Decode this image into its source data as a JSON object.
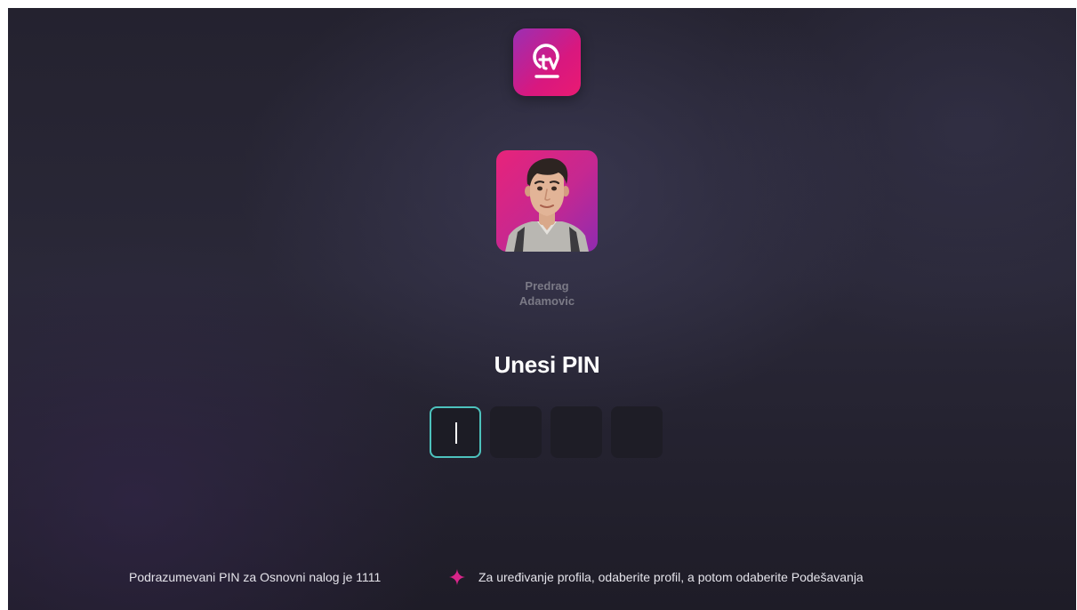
{
  "app": {
    "logo_icon": "tv-logo-icon",
    "brand_color_start": "#9b2fb3",
    "brand_color_end": "#ea1a72"
  },
  "profile": {
    "avatar_icon": "avatar-icon",
    "first_name": "Predrag",
    "last_name": "Adamovic"
  },
  "pin": {
    "title": "Unesi PIN",
    "digit_count": 4,
    "filled": 0,
    "active_index": 0,
    "focus_color": "#4dc2bd"
  },
  "footer": {
    "left_text": "Podrazumevani PIN za Osnovni nalog je 1111",
    "separator_icon": "sparkle-icon",
    "separator_color": "#d8258a",
    "right_text": "Za uređivanje profila, odaberite profil, a potom odaberite Podešavanja"
  }
}
